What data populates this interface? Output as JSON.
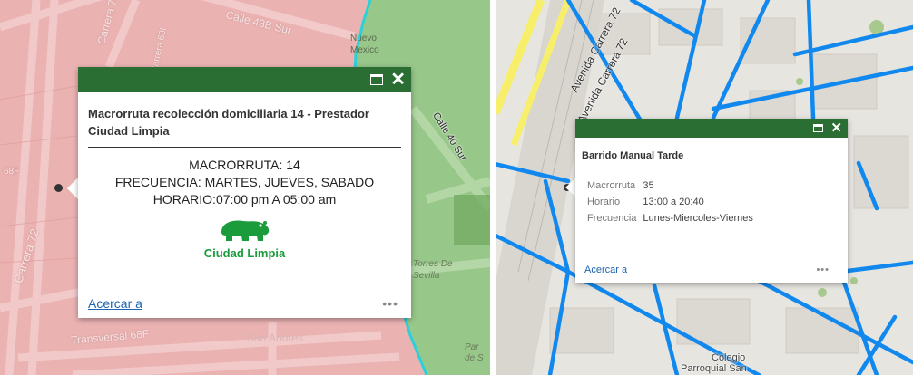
{
  "left_map": {
    "street_labels": [
      "Calle 43B Sur",
      "Carrera 72",
      "Carrera 68I",
      "Calle 40 Sur",
      "Carrera 72",
      "Transversal 68F",
      "68F"
    ],
    "area_labels": [
      "Nuevo Mexico",
      "Torres De Sevilla",
      "San Andrés",
      "Par de S"
    ],
    "colors": {
      "zone_pink": "#e9a8a8",
      "zone_green": "#8fbf7e",
      "boundary": "#2bd0d8"
    },
    "popup": {
      "title": "Macrorruta recolección domiciliaria 14 - Prestador Ciudad Limpia",
      "macroruta_label": "MACRORRUTA:",
      "macroruta_value": "14",
      "frecuencia_label": "FRECUENCIA:",
      "frecuencia_value": "MARTES, JUEVES, SABADO",
      "horario_label": "HORARIO:",
      "horario_value": "07:00 pm A 05:00 am",
      "logo_text": "Ciudad Limpia",
      "zoom_link": "Acercar a",
      "more": "•••"
    }
  },
  "right_map": {
    "street_labels": [
      "Avenida Carrera 72",
      "Avenida Carrera 72"
    ],
    "area_labels": [
      "Colegio",
      "Parroquial San"
    ],
    "colors": {
      "route_blue": "#1188ee",
      "highway_yellow": "#f7ef6a",
      "base": "#e9e8e3"
    },
    "popup": {
      "title": "Barrido Manual Tarde",
      "rows": [
        {
          "key": "Macrorruta",
          "value": "35"
        },
        {
          "key": "Horario",
          "value": "13:00 a 20:40"
        },
        {
          "key": "Frecuencia",
          "value": "Lunes-Miercoles-Viernes"
        }
      ],
      "zoom_link": "Acercar a",
      "more": "•••"
    }
  }
}
